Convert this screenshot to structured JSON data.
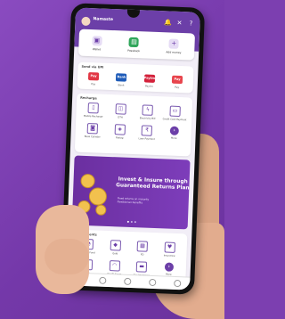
{
  "header": {
    "greeting": "Namaste",
    "icons": [
      "bell-icon",
      "scan-icon",
      "help-icon"
    ]
  },
  "quick_actions": [
    {
      "label": "Wallet",
      "icon": "wallet-icon"
    },
    {
      "label": "Passbook",
      "icon": "passbook-icon"
    },
    {
      "label": "Add money",
      "icon": "add-money-icon"
    }
  ],
  "upi": {
    "title": "Send via UPI",
    "apps": [
      {
        "label": "Pay",
        "logo": "Pay",
        "color": "#e23744"
      },
      {
        "label": "Bank",
        "logo": "Bank",
        "color": "#1e5bb8"
      },
      {
        "label": "Paytm",
        "logo": "Paytm",
        "color": "#d4223b"
      },
      {
        "label": "Pay",
        "logo": "Pay",
        "color": "#e8454d"
      }
    ]
  },
  "recharge": {
    "title": "Recharge",
    "items": [
      {
        "label": "Mobile Recharge",
        "icon": "mobile-icon"
      },
      {
        "label": "DTH",
        "icon": "dth-icon"
      },
      {
        "label": "Electricity Bill",
        "icon": "electricity-icon"
      },
      {
        "label": "Credit Card Payment",
        "icon": "credit-card-icon"
      },
      {
        "label": "Book Cylinder",
        "icon": "cylinder-icon"
      },
      {
        "label": "Fastag",
        "icon": "fastag-icon"
      },
      {
        "label": "Loan Payment",
        "icon": "loan-icon"
      },
      {
        "label": "More",
        "icon": "more-icon"
      }
    ]
  },
  "banner": {
    "title": "Invest & Insure through Guaranteed Returns Plan",
    "points": [
      "Fixed returns on maturity",
      "Flexible tax benefits"
    ]
  },
  "invest": {
    "title": "Investments",
    "items": [
      {
        "label": "Mutual Fund",
        "icon": "mutual-fund-icon"
      },
      {
        "label": "Gold",
        "icon": "gold-icon"
      },
      {
        "label": "FD",
        "icon": "fd-icon"
      },
      {
        "label": "Insurance",
        "icon": "insurance-icon"
      },
      {
        "label": "Loan",
        "icon": "loan-icon"
      },
      {
        "label": "Credit Score",
        "icon": "score-icon"
      },
      {
        "label": "Car Insurance",
        "icon": "car-icon"
      },
      {
        "label": "More",
        "icon": "more-icon"
      }
    ]
  },
  "bottom_nav": [
    "home-icon",
    "payment-icon",
    "scan-icon",
    "history-icon",
    "profile-icon"
  ]
}
